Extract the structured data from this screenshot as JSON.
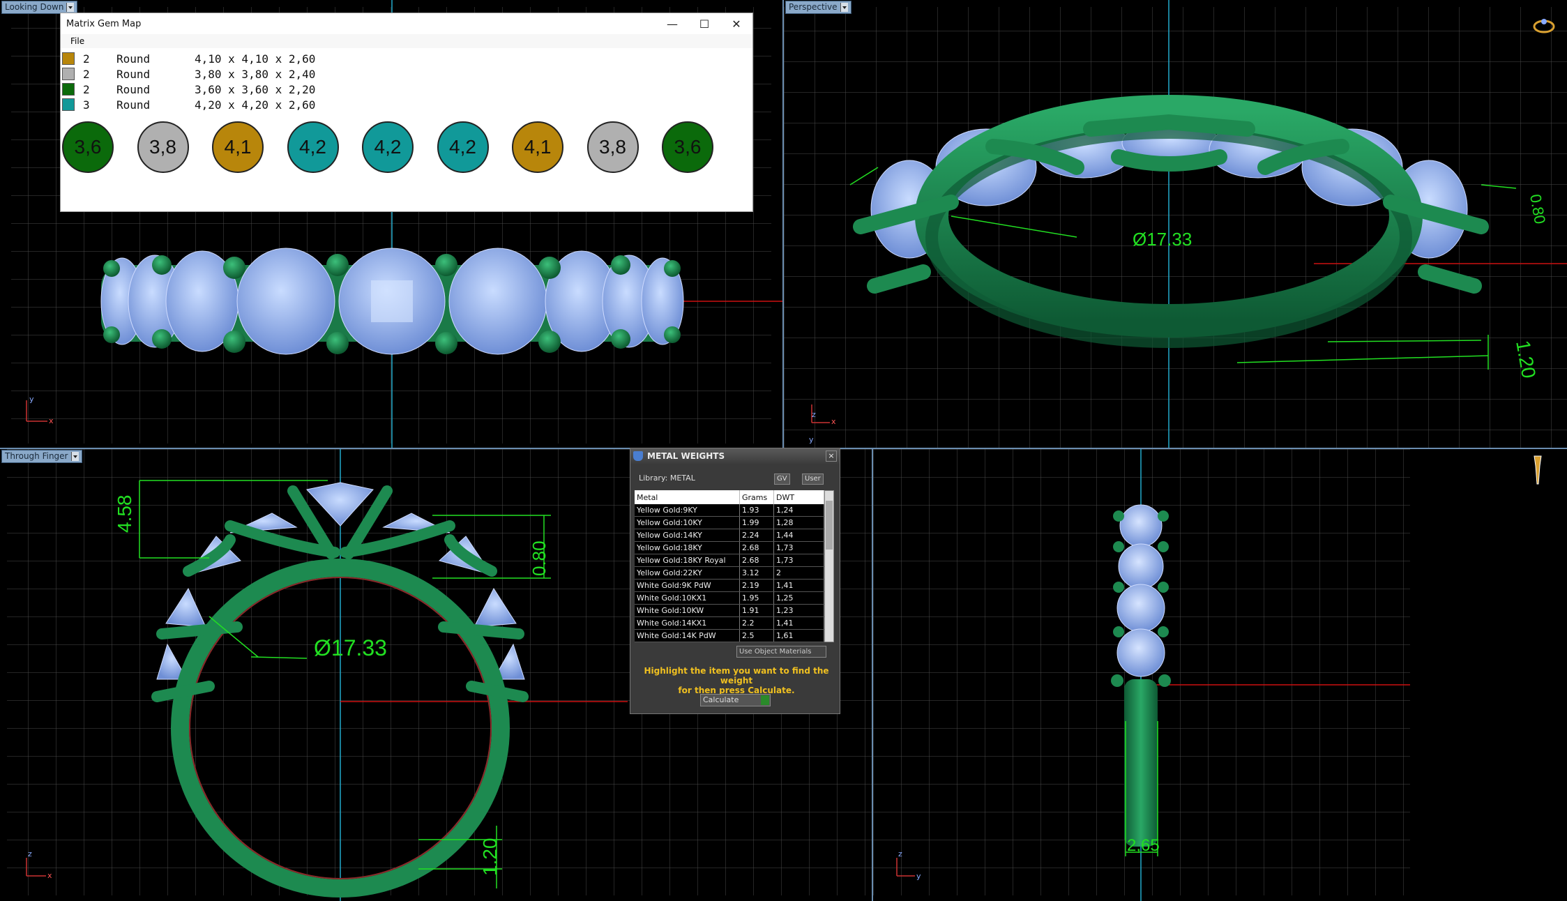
{
  "viewports": {
    "top_left": {
      "label": "Looking Down"
    },
    "top_right": {
      "label": "Perspective"
    },
    "bottom_left": {
      "label": "Through Finger"
    }
  },
  "gem_map": {
    "title": "Matrix Gem Map",
    "menu": "File",
    "window_controls": {
      "minimize": "—",
      "maximize": "☐",
      "close": "✕"
    },
    "rows": [
      {
        "color": "#b8860b",
        "count": "2",
        "shape": "Round",
        "size": "4,10 x 4,10 x 2,60"
      },
      {
        "color": "#b0b0b0",
        "count": "2",
        "shape": "Round",
        "size": "3,80 x 3,80 x 2,40"
      },
      {
        "color": "#0b6a0b",
        "count": "2",
        "shape": "Round",
        "size": "3,60 x 3,60 x 2,20"
      },
      {
        "color": "#119999",
        "count": "3",
        "shape": "Round",
        "size": "4,20 x 4,20 x 2,60"
      }
    ],
    "circles": [
      {
        "label": "3,6",
        "color": "#0b6a0b"
      },
      {
        "label": "3,8",
        "color": "#b0b0b0"
      },
      {
        "label": "4,1",
        "color": "#b8860b"
      },
      {
        "label": "4,2",
        "color": "#119999"
      },
      {
        "label": "4,2",
        "color": "#119999"
      },
      {
        "label": "4,2",
        "color": "#119999"
      },
      {
        "label": "4,1",
        "color": "#b8860b"
      },
      {
        "label": "3,8",
        "color": "#b0b0b0"
      },
      {
        "label": "3,6",
        "color": "#0b6a0b"
      }
    ]
  },
  "metal_weights": {
    "title": "METAL WEIGHTS",
    "library": "Library: METAL",
    "gv_button": "GV",
    "user_button": "User",
    "columns": [
      "Metal",
      "Grams",
      "DWT"
    ],
    "rows": [
      [
        "Yellow Gold:9KY",
        "1.93",
        "1,24"
      ],
      [
        "Yellow Gold:10KY",
        "1.99",
        "1,28"
      ],
      [
        "Yellow Gold:14KY",
        "2.24",
        "1,44"
      ],
      [
        "Yellow Gold:18KY",
        "2.68",
        "1,73"
      ],
      [
        "Yellow Gold:18KY Royal",
        "2.68",
        "1,73"
      ],
      [
        "Yellow Gold:22KY",
        "3.12",
        "2"
      ],
      [
        "White Gold:9K PdW",
        "2.19",
        "1,41"
      ],
      [
        "White Gold:10KX1",
        "1.95",
        "1,25"
      ],
      [
        "White Gold:10KW",
        "1.91",
        "1,23"
      ],
      [
        "White Gold:14KX1",
        "2.2",
        "1,41"
      ],
      [
        "White Gold:14K PdW",
        "2.5",
        "1,61"
      ]
    ],
    "use_object_materials": "Use Object Materials",
    "hint_line1": "Highlight the item you want to find the weight",
    "hint_line2": "for then press Calculate.",
    "calculate": "Calculate"
  },
  "dimensions": {
    "diameter": "Ø17.33",
    "top_height": "4.58",
    "band_top": "0.80",
    "band_bottom": "1.20",
    "side_width": "2,65",
    "persp_top": "0.80",
    "persp_bottom": "1.20"
  },
  "colors": {
    "metal": "#1e8a50",
    "stone": "#9cb8f0",
    "grid": "#4a4a4a",
    "dim": "#22e022",
    "axis_red": "#cc1111",
    "axis_cyan": "#22aacc"
  }
}
